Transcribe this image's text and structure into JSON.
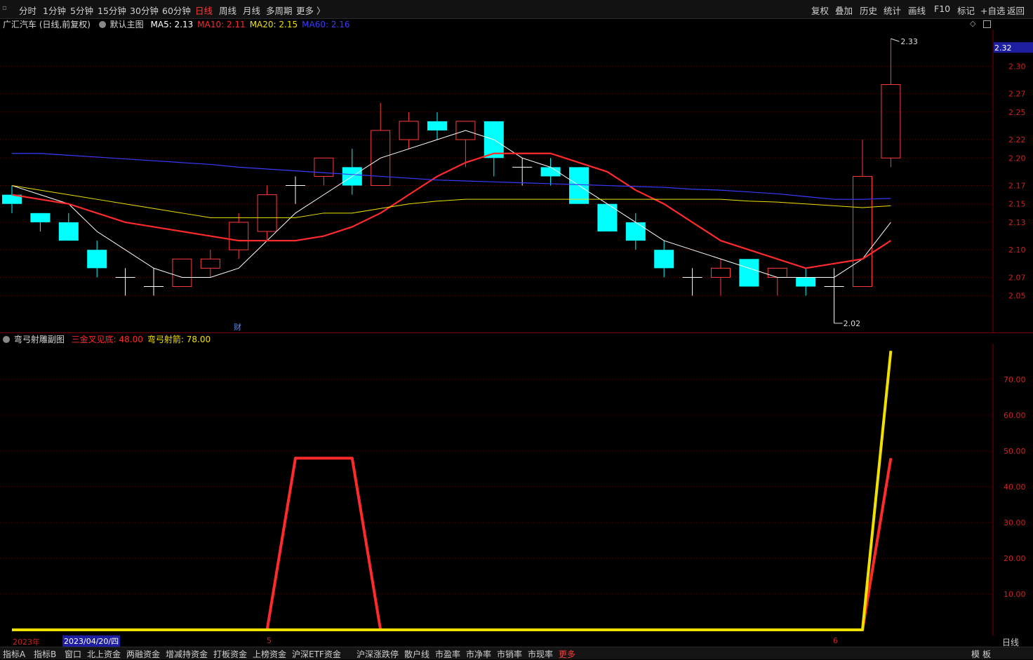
{
  "toolbar": {
    "periods": [
      "分时",
      "1分钟",
      "5分钟",
      "15分钟",
      "30分钟",
      "60分钟",
      "日线",
      "周线",
      "月线",
      "多周期",
      "更多 〉"
    ],
    "active_period": "日线",
    "right_buttons": [
      "复权",
      "叠加",
      "历史",
      "统计",
      "画线",
      "F10",
      "标记",
      "+自选",
      "返回"
    ]
  },
  "main_chart": {
    "stock": "广汇汽车 (日线,前复权)",
    "template": "默认主图",
    "ma": [
      {
        "label": "MA5: 2.13",
        "color": "#ffffff"
      },
      {
        "label": "MA10: 2.11",
        "color": "#ff2a2a"
      },
      {
        "label": "MA20: 2.15",
        "color": "#f0e000"
      },
      {
        "label": "MA60: 2.16",
        "color": "#3a3aff"
      }
    ],
    "current_price": "2.32",
    "high_label": "2.33",
    "low_label": "2.02",
    "event_marker": "财"
  },
  "sub_chart": {
    "name": "弯弓射雕副图",
    "series_labels": [
      {
        "label": "三金叉见底: 48.00",
        "color": "#ff2a2a"
      },
      {
        "label": "弯弓射箭: 78.00",
        "color": "#f0e000"
      }
    ]
  },
  "date_axis": {
    "year": "2023年",
    "cursor_date": "2023/04/20/四",
    "month_5": "5",
    "month_6": "6",
    "period": "日线"
  },
  "bottom_tabs": [
    "指标A",
    "指标B",
    "窗口",
    "北上资金",
    "两融资金",
    "增减持资金",
    "打板资金",
    "上榜资金",
    "沪深ETF资金",
    "沪深涨跌停",
    "散户线",
    "市盈率",
    "市净率",
    "市销率",
    "市现率",
    "更多"
  ],
  "bottom_right": [
    "模",
    "板"
  ],
  "chart_data": [
    {
      "type": "candlestick",
      "title": "广汇汽车 (日线,前复权)",
      "y_ticks": [
        "2.30",
        "2.27",
        "2.25",
        "2.22",
        "2.20",
        "2.17",
        "2.15",
        "2.13",
        "2.10",
        "2.07",
        "2.05"
      ],
      "ylim": [
        2.01,
        2.34
      ],
      "candles": [
        {
          "o": 2.16,
          "c": 2.15,
          "h": 2.17,
          "l": 2.14
        },
        {
          "o": 2.14,
          "c": 2.13,
          "h": 2.14,
          "l": 2.12
        },
        {
          "o": 2.13,
          "c": 2.11,
          "h": 2.14,
          "l": 2.11
        },
        {
          "o": 2.1,
          "c": 2.08,
          "h": 2.11,
          "l": 2.07
        },
        {
          "o": 2.07,
          "c": 2.07,
          "h": 2.08,
          "l": 2.05
        },
        {
          "o": 2.06,
          "c": 2.06,
          "h": 2.08,
          "l": 2.05
        },
        {
          "o": 2.06,
          "c": 2.09,
          "h": 2.09,
          "l": 2.06
        },
        {
          "o": 2.08,
          "c": 2.09,
          "h": 2.1,
          "l": 2.07
        },
        {
          "o": 2.1,
          "c": 2.13,
          "h": 2.14,
          "l": 2.09
        },
        {
          "o": 2.12,
          "c": 2.16,
          "h": 2.17,
          "l": 2.11
        },
        {
          "o": 2.17,
          "c": 2.17,
          "h": 2.18,
          "l": 2.15
        },
        {
          "o": 2.18,
          "c": 2.2,
          "h": 2.2,
          "l": 2.17
        },
        {
          "o": 2.19,
          "c": 2.17,
          "h": 2.21,
          "l": 2.16
        },
        {
          "o": 2.17,
          "c": 2.23,
          "h": 2.26,
          "l": 2.17
        },
        {
          "o": 2.22,
          "c": 2.24,
          "h": 2.25,
          "l": 2.21
        },
        {
          "o": 2.24,
          "c": 2.23,
          "h": 2.25,
          "l": 2.22
        },
        {
          "o": 2.22,
          "c": 2.24,
          "h": 2.24,
          "l": 2.19
        },
        {
          "o": 2.24,
          "c": 2.2,
          "h": 2.24,
          "l": 2.18
        },
        {
          "o": 2.19,
          "c": 2.19,
          "h": 2.2,
          "l": 2.17
        },
        {
          "o": 2.19,
          "c": 2.18,
          "h": 2.2,
          "l": 2.17
        },
        {
          "o": 2.19,
          "c": 2.15,
          "h": 2.19,
          "l": 2.15
        },
        {
          "o": 2.15,
          "c": 2.12,
          "h": 2.15,
          "l": 2.12
        },
        {
          "o": 2.13,
          "c": 2.11,
          "h": 2.14,
          "l": 2.1
        },
        {
          "o": 2.1,
          "c": 2.08,
          "h": 2.11,
          "l": 2.07
        },
        {
          "o": 2.07,
          "c": 2.07,
          "h": 2.08,
          "l": 2.05
        },
        {
          "o": 2.07,
          "c": 2.08,
          "h": 2.09,
          "l": 2.05
        },
        {
          "o": 2.09,
          "c": 2.06,
          "h": 2.09,
          "l": 2.06
        },
        {
          "o": 2.07,
          "c": 2.08,
          "h": 2.08,
          "l": 2.05
        },
        {
          "o": 2.07,
          "c": 2.06,
          "h": 2.08,
          "l": 2.05
        },
        {
          "o": 2.06,
          "c": 2.06,
          "h": 2.08,
          "l": 2.02
        },
        {
          "o": 2.06,
          "c": 2.18,
          "h": 2.22,
          "l": 2.06
        },
        {
          "o": 2.2,
          "c": 2.28,
          "h": 2.33,
          "l": 2.19
        }
      ],
      "ma_series": [
        {
          "name": "MA5",
          "values": [
            2.17,
            2.16,
            2.15,
            2.12,
            2.1,
            2.08,
            2.07,
            2.07,
            2.08,
            2.11,
            2.14,
            2.16,
            2.18,
            2.2,
            2.21,
            2.22,
            2.23,
            2.22,
            2.2,
            2.19,
            2.17,
            2.15,
            2.13,
            2.11,
            2.1,
            2.09,
            2.08,
            2.07,
            2.07,
            2.07,
            2.09,
            2.13
          ]
        },
        {
          "name": "MA10",
          "values": [
            2.16,
            2.155,
            2.15,
            2.14,
            2.13,
            2.125,
            2.12,
            2.115,
            2.11,
            2.11,
            2.11,
            2.115,
            2.125,
            2.14,
            2.16,
            2.18,
            2.195,
            2.205,
            2.205,
            2.205,
            2.195,
            2.185,
            2.165,
            2.15,
            2.13,
            2.11,
            2.1,
            2.09,
            2.08,
            2.085,
            2.09,
            2.11
          ]
        },
        {
          "name": "MA20",
          "values": [
            2.17,
            2.165,
            2.16,
            2.155,
            2.15,
            2.145,
            2.14,
            2.135,
            2.135,
            2.135,
            2.135,
            2.14,
            2.14,
            2.145,
            2.15,
            2.153,
            2.155,
            2.155,
            2.155,
            2.155,
            2.155,
            2.155,
            2.155,
            2.155,
            2.155,
            2.155,
            2.153,
            2.152,
            2.15,
            2.148,
            2.146,
            2.148
          ]
        },
        {
          "name": "MA60",
          "values": [
            2.205,
            2.205,
            2.203,
            2.201,
            2.199,
            2.197,
            2.195,
            2.193,
            2.19,
            2.188,
            2.186,
            2.184,
            2.182,
            2.18,
            2.178,
            2.176,
            2.175,
            2.174,
            2.173,
            2.172,
            2.171,
            2.17,
            2.169,
            2.168,
            2.166,
            2.165,
            2.163,
            2.161,
            2.158,
            2.155,
            2.155,
            2.156
          ]
        }
      ]
    },
    {
      "type": "line",
      "title": "弯弓射雕副图",
      "y_ticks": [
        "70.00",
        "60.00",
        "50.00",
        "40.00",
        "30.00",
        "20.00",
        "10.00"
      ],
      "ylim": [
        0,
        80
      ],
      "series": [
        {
          "name": "三金叉见底",
          "color": "#ff2a2a",
          "values": [
            0,
            0,
            0,
            0,
            0,
            0,
            0,
            0,
            0,
            0,
            48,
            48,
            48,
            0,
            0,
            0,
            0,
            0,
            0,
            0,
            0,
            0,
            0,
            0,
            0,
            0,
            0,
            0,
            0,
            0,
            0,
            48
          ]
        },
        {
          "name": "弯弓射箭",
          "color": "#f0e000",
          "values": [
            0,
            0,
            0,
            0,
            0,
            0,
            0,
            0,
            0,
            0,
            0,
            0,
            0,
            0,
            0,
            0,
            0,
            0,
            0,
            0,
            0,
            0,
            0,
            0,
            0,
            0,
            0,
            0,
            0,
            0,
            0,
            78
          ]
        }
      ]
    }
  ]
}
